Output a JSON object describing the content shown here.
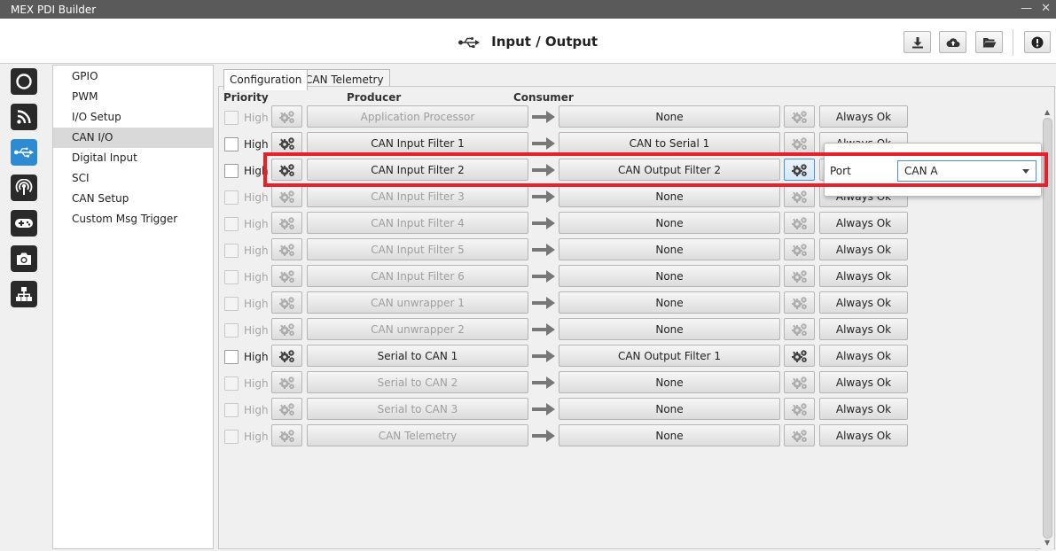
{
  "window": {
    "title": "MEX PDI Builder"
  },
  "header": {
    "title": "Input / Output",
    "icon": "usb-icon"
  },
  "header_buttons": [
    {
      "name": "download-icon"
    },
    {
      "name": "cloud-upload-icon"
    },
    {
      "name": "folder-open-icon"
    },
    {
      "name": "alert-icon"
    }
  ],
  "rail": [
    {
      "name": "power-icon"
    },
    {
      "name": "rss-icon"
    },
    {
      "name": "usb-icon",
      "active": true
    },
    {
      "name": "broadcast-icon"
    },
    {
      "name": "gamepad-icon"
    },
    {
      "name": "camera-icon"
    },
    {
      "name": "network-icon"
    }
  ],
  "nav": {
    "items": [
      "GPIO",
      "PWM",
      "I/O Setup",
      "CAN I/O",
      "Digital Input",
      "SCI",
      "CAN Setup",
      "Custom Msg Trigger"
    ],
    "selected": "CAN I/O"
  },
  "tabs": [
    "Configuration",
    "CAN Telemetry"
  ],
  "columns": {
    "priority": "Priority",
    "producer": "Producer",
    "consumer": "Consumer"
  },
  "rows": [
    {
      "priority": "High",
      "producer": "Application Processor",
      "consumer": "None",
      "status": "Always Ok",
      "enabled": false
    },
    {
      "priority": "High",
      "producer": "CAN Input Filter 1",
      "consumer": "CAN to Serial 1",
      "status": "Always Ok",
      "enabled": true
    },
    {
      "priority": "High",
      "producer": "CAN Input Filter 2",
      "consumer": "CAN Output Filter 2",
      "status": "Always Ok",
      "enabled": true
    },
    {
      "priority": "High",
      "producer": "CAN Input Filter 3",
      "consumer": "None",
      "status": "Always Ok",
      "enabled": false
    },
    {
      "priority": "High",
      "producer": "CAN Input Filter 4",
      "consumer": "None",
      "status": "Always Ok",
      "enabled": false
    },
    {
      "priority": "High",
      "producer": "CAN Input Filter 5",
      "consumer": "None",
      "status": "Always Ok",
      "enabled": false
    },
    {
      "priority": "High",
      "producer": "CAN Input Filter 6",
      "consumer": "None",
      "status": "Always Ok",
      "enabled": false
    },
    {
      "priority": "High",
      "producer": "CAN unwrapper 1",
      "consumer": "None",
      "status": "Always Ok",
      "enabled": false
    },
    {
      "priority": "High",
      "producer": "CAN unwrapper 2",
      "consumer": "None",
      "status": "Always Ok",
      "enabled": false
    },
    {
      "priority": "High",
      "producer": "Serial to CAN 1",
      "consumer": "CAN Output Filter 1",
      "status": "Always Ok",
      "enabled": true
    },
    {
      "priority": "High",
      "producer": "Serial to CAN 2",
      "consumer": "None",
      "status": "Always Ok",
      "enabled": false
    },
    {
      "priority": "High",
      "producer": "Serial to CAN 3",
      "consumer": "None",
      "status": "Always Ok",
      "enabled": false
    },
    {
      "priority": "High",
      "producer": "CAN Telemetry",
      "consumer": "None",
      "status": "Always Ok",
      "enabled": false
    }
  ],
  "popup": {
    "label": "Port",
    "value": "CAN A"
  },
  "colors": {
    "accent": "#2d8bd4",
    "highlight": "#e8202a"
  }
}
